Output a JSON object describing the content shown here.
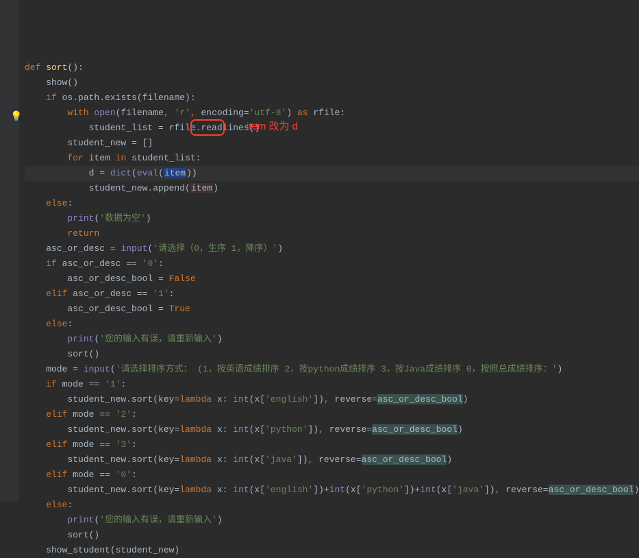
{
  "annotation": {
    "text": "item 改为 d"
  },
  "code": {
    "lines": [
      {
        "indent": 0,
        "tokens": [
          {
            "t": "def ",
            "c": "kw"
          },
          {
            "t": "sort",
            "c": "fn"
          },
          {
            "t": "():",
            "c": ""
          }
        ]
      },
      {
        "indent": 1,
        "tokens": [
          {
            "t": "show()",
            "c": ""
          }
        ]
      },
      {
        "indent": 1,
        "tokens": [
          {
            "t": "if ",
            "c": "kw"
          },
          {
            "t": "os.path.exists(filename):",
            "c": ""
          }
        ]
      },
      {
        "indent": 2,
        "tokens": [
          {
            "t": "with ",
            "c": "kw"
          },
          {
            "t": "open",
            "c": "builtin"
          },
          {
            "t": "(filename",
            "c": ""
          },
          {
            "t": ", ",
            "c": "kw"
          },
          {
            "t": "'r'",
            "c": "str"
          },
          {
            "t": ", ",
            "c": "kw"
          },
          {
            "t": "encoding",
            "c": ""
          },
          {
            "t": "=",
            "c": ""
          },
          {
            "t": "'utf-8'",
            "c": "str"
          },
          {
            "t": ") ",
            "c": ""
          },
          {
            "t": "as ",
            "c": "kw"
          },
          {
            "t": "rfile:",
            "c": ""
          }
        ]
      },
      {
        "indent": 3,
        "tokens": [
          {
            "t": "student_list = rfile.readlines()",
            "c": ""
          }
        ]
      },
      {
        "indent": 2,
        "tokens": [
          {
            "t": "student_new = []",
            "c": ""
          }
        ]
      },
      {
        "indent": 2,
        "tokens": [
          {
            "t": "for ",
            "c": "kw"
          },
          {
            "t": "item ",
            "c": ""
          },
          {
            "t": "in ",
            "c": "kw"
          },
          {
            "t": "student_list:",
            "c": ""
          }
        ]
      },
      {
        "indent": 3,
        "hl": true,
        "tokens": [
          {
            "t": "d = ",
            "c": ""
          },
          {
            "t": "dict",
            "c": "builtin"
          },
          {
            "t": "(",
            "c": ""
          },
          {
            "t": "eval",
            "c": "builtin"
          },
          {
            "t": "(",
            "c": ""
          },
          {
            "t": "item",
            "c": "bg-hl"
          },
          {
            "t": "))",
            "c": ""
          }
        ]
      },
      {
        "indent": 3,
        "tokens": [
          {
            "t": "student_new.append(",
            "c": ""
          },
          {
            "t": "item",
            "c": "bg-var"
          },
          {
            "t": ")",
            "c": ""
          }
        ]
      },
      {
        "indent": 1,
        "tokens": [
          {
            "t": "else",
            "c": "kw"
          },
          {
            "t": ":",
            "c": ""
          }
        ]
      },
      {
        "indent": 2,
        "tokens": [
          {
            "t": "print",
            "c": "builtin"
          },
          {
            "t": "(",
            "c": ""
          },
          {
            "t": "'数据为空'",
            "c": "str"
          },
          {
            "t": ")",
            "c": ""
          }
        ]
      },
      {
        "indent": 2,
        "tokens": [
          {
            "t": "return",
            "c": "kw"
          }
        ]
      },
      {
        "indent": 1,
        "tokens": [
          {
            "t": "asc_or_desc = ",
            "c": ""
          },
          {
            "t": "input",
            "c": "builtin"
          },
          {
            "t": "(",
            "c": ""
          },
          {
            "t": "'请选择（0，生序 1，降序）'",
            "c": "str"
          },
          {
            "t": ")",
            "c": ""
          }
        ]
      },
      {
        "indent": 1,
        "tokens": [
          {
            "t": "if ",
            "c": "kw"
          },
          {
            "t": "asc_or_desc == ",
            "c": ""
          },
          {
            "t": "'0'",
            "c": "str"
          },
          {
            "t": ":",
            "c": ""
          }
        ]
      },
      {
        "indent": 2,
        "tokens": [
          {
            "t": "asc_or_desc_bool = ",
            "c": ""
          },
          {
            "t": "False",
            "c": "kw"
          }
        ]
      },
      {
        "indent": 1,
        "tokens": [
          {
            "t": "elif ",
            "c": "kw"
          },
          {
            "t": "asc_or_desc == ",
            "c": ""
          },
          {
            "t": "'1'",
            "c": "str"
          },
          {
            "t": ":",
            "c": ""
          }
        ]
      },
      {
        "indent": 2,
        "tokens": [
          {
            "t": "asc_or_desc_bool = ",
            "c": ""
          },
          {
            "t": "True",
            "c": "kw"
          }
        ]
      },
      {
        "indent": 1,
        "tokens": [
          {
            "t": "else",
            "c": "kw"
          },
          {
            "t": ":",
            "c": ""
          }
        ]
      },
      {
        "indent": 2,
        "tokens": [
          {
            "t": "print",
            "c": "builtin"
          },
          {
            "t": "(",
            "c": ""
          },
          {
            "t": "'您的输入有误，请重新输入'",
            "c": "str"
          },
          {
            "t": ")",
            "c": ""
          }
        ]
      },
      {
        "indent": 2,
        "tokens": [
          {
            "t": "sort()",
            "c": ""
          }
        ]
      },
      {
        "indent": 1,
        "tokens": [
          {
            "t": "mode = ",
            "c": ""
          },
          {
            "t": "input",
            "c": "builtin"
          },
          {
            "t": "(",
            "c": ""
          },
          {
            "t": "'请选择排序方式： (1，按英语成绩排序 2，按python成绩排序 3，按Java成绩排序 0，按照总成绩排序：'",
            "c": "str"
          },
          {
            "t": ")",
            "c": ""
          }
        ]
      },
      {
        "indent": 1,
        "tokens": [
          {
            "t": "if ",
            "c": "kw"
          },
          {
            "t": "mode == ",
            "c": ""
          },
          {
            "t": "'1'",
            "c": "str"
          },
          {
            "t": ":",
            "c": ""
          }
        ]
      },
      {
        "indent": 2,
        "tokens": [
          {
            "t": "student_new.sort(",
            "c": ""
          },
          {
            "t": "key",
            "c": ""
          },
          {
            "t": "=",
            "c": ""
          },
          {
            "t": "lambda ",
            "c": "kw"
          },
          {
            "t": "x: ",
            "c": ""
          },
          {
            "t": "int",
            "c": "builtin"
          },
          {
            "t": "(x[",
            "c": ""
          },
          {
            "t": "'english'",
            "c": "str"
          },
          {
            "t": "])",
            "c": ""
          },
          {
            "t": ", ",
            "c": "kw"
          },
          {
            "t": "reverse",
            "c": ""
          },
          {
            "t": "=",
            "c": ""
          },
          {
            "t": "asc_or_desc_bool",
            "c": "bg-match"
          },
          {
            "t": ")",
            "c": ""
          }
        ]
      },
      {
        "indent": 1,
        "tokens": [
          {
            "t": "elif ",
            "c": "kw"
          },
          {
            "t": "mode == ",
            "c": ""
          },
          {
            "t": "'2'",
            "c": "str"
          },
          {
            "t": ":",
            "c": ""
          }
        ]
      },
      {
        "indent": 2,
        "tokens": [
          {
            "t": "student_new.sort(",
            "c": ""
          },
          {
            "t": "key",
            "c": ""
          },
          {
            "t": "=",
            "c": ""
          },
          {
            "t": "lambda ",
            "c": "kw"
          },
          {
            "t": "x: ",
            "c": ""
          },
          {
            "t": "int",
            "c": "builtin"
          },
          {
            "t": "(x[",
            "c": ""
          },
          {
            "t": "'python'",
            "c": "str"
          },
          {
            "t": "])",
            "c": ""
          },
          {
            "t": ", ",
            "c": "kw"
          },
          {
            "t": "reverse",
            "c": ""
          },
          {
            "t": "=",
            "c": ""
          },
          {
            "t": "asc_or_desc_bool",
            "c": "bg-match"
          },
          {
            "t": ")",
            "c": ""
          }
        ]
      },
      {
        "indent": 1,
        "tokens": [
          {
            "t": "elif ",
            "c": "kw"
          },
          {
            "t": "mode == ",
            "c": ""
          },
          {
            "t": "'3'",
            "c": "str"
          },
          {
            "t": ":",
            "c": ""
          }
        ]
      },
      {
        "indent": 2,
        "tokens": [
          {
            "t": "student_new.sort(",
            "c": ""
          },
          {
            "t": "key",
            "c": ""
          },
          {
            "t": "=",
            "c": ""
          },
          {
            "t": "lambda ",
            "c": "kw"
          },
          {
            "t": "x: ",
            "c": ""
          },
          {
            "t": "int",
            "c": "builtin"
          },
          {
            "t": "(x[",
            "c": ""
          },
          {
            "t": "'java'",
            "c": "str"
          },
          {
            "t": "])",
            "c": ""
          },
          {
            "t": ", ",
            "c": "kw"
          },
          {
            "t": "reverse",
            "c": ""
          },
          {
            "t": "=",
            "c": ""
          },
          {
            "t": "asc_or_desc_bool",
            "c": "bg-match"
          },
          {
            "t": ")",
            "c": ""
          }
        ]
      },
      {
        "indent": 1,
        "tokens": [
          {
            "t": "elif ",
            "c": "kw"
          },
          {
            "t": "mode == ",
            "c": ""
          },
          {
            "t": "'0'",
            "c": "str"
          },
          {
            "t": ":",
            "c": ""
          }
        ]
      },
      {
        "indent": 2,
        "tokens": [
          {
            "t": "student_new.sort(",
            "c": ""
          },
          {
            "t": "key",
            "c": ""
          },
          {
            "t": "=",
            "c": ""
          },
          {
            "t": "lambda ",
            "c": "kw"
          },
          {
            "t": "x: ",
            "c": ""
          },
          {
            "t": "int",
            "c": "builtin"
          },
          {
            "t": "(x[",
            "c": ""
          },
          {
            "t": "'english'",
            "c": "str"
          },
          {
            "t": "])+",
            "c": ""
          },
          {
            "t": "int",
            "c": "builtin"
          },
          {
            "t": "(x[",
            "c": ""
          },
          {
            "t": "'python'",
            "c": "str"
          },
          {
            "t": "])+",
            "c": ""
          },
          {
            "t": "int",
            "c": "builtin"
          },
          {
            "t": "(x[",
            "c": ""
          },
          {
            "t": "'java'",
            "c": "str"
          },
          {
            "t": "])",
            "c": ""
          },
          {
            "t": ", ",
            "c": "kw"
          },
          {
            "t": "reverse",
            "c": ""
          },
          {
            "t": "=",
            "c": ""
          },
          {
            "t": "asc_or_desc_bool",
            "c": "bg-match"
          },
          {
            "t": ")",
            "c": ""
          }
        ]
      },
      {
        "indent": 1,
        "tokens": [
          {
            "t": "else",
            "c": "kw"
          },
          {
            "t": ":",
            "c": ""
          }
        ]
      },
      {
        "indent": 2,
        "tokens": [
          {
            "t": "print",
            "c": "builtin"
          },
          {
            "t": "(",
            "c": ""
          },
          {
            "t": "'您的输入有误，请重新输入'",
            "c": "str"
          },
          {
            "t": ")",
            "c": ""
          }
        ]
      },
      {
        "indent": 2,
        "tokens": [
          {
            "t": "sort()",
            "c": ""
          }
        ]
      },
      {
        "indent": 1,
        "tokens": [
          {
            "t": "show_student(student_new)",
            "c": ""
          }
        ]
      }
    ]
  }
}
